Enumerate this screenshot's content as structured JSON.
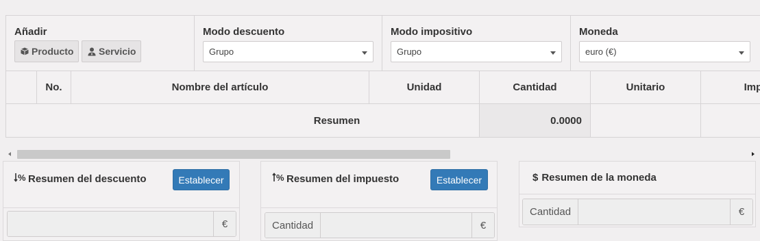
{
  "add": {
    "title": "Añadir",
    "product_label": "Producto",
    "service_label": "Servicio"
  },
  "discount_mode": {
    "title": "Modo descuento",
    "value": "Grupo"
  },
  "tax_mode": {
    "title": "Modo impositivo",
    "value": "Grupo"
  },
  "currency": {
    "title": "Moneda",
    "value": "euro (€)"
  },
  "columns": {
    "no": "No.",
    "item_name": "Nombre del artículo",
    "unit": "Unidad",
    "quantity": "Cantidad",
    "unit_price": "Unitario",
    "amount": "Impo"
  },
  "summary_row": {
    "label": "Resumen",
    "quantity": "0.0000"
  },
  "discount_panel": {
    "title": "Resumen del descuento",
    "button": "Establecer",
    "symbol": "€"
  },
  "tax_panel": {
    "title": "Resumen del impuesto",
    "button": "Establecer",
    "addon_left": "Cantidad",
    "symbol": "€"
  },
  "currency_panel": {
    "title": "Resumen de la moneda",
    "dollar": "$",
    "addon_left": "Cantidad",
    "symbol": "€"
  },
  "icons": {
    "product": "cube-icon",
    "service": "user-tie-icon",
    "discount": "sort-amount-down-percent-icon",
    "tax": "sort-amount-up-percent-icon"
  }
}
